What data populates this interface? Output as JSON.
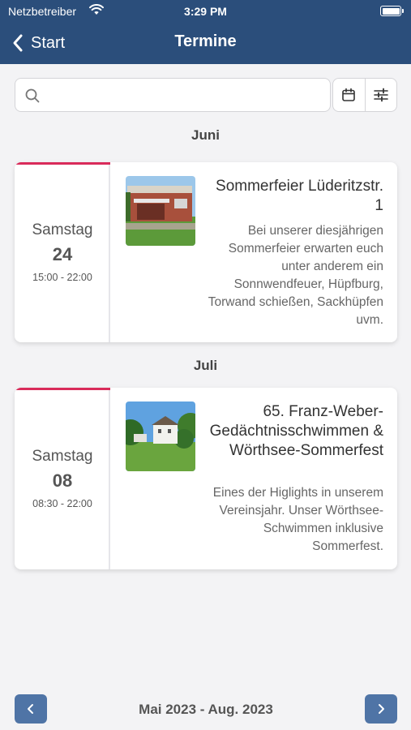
{
  "status_bar": {
    "carrier": "Netzbetreiber",
    "time": "3:29 PM"
  },
  "header": {
    "back_label": "Start",
    "title": "Termine"
  },
  "search": {
    "placeholder": "",
    "value": ""
  },
  "sections": [
    {
      "month": "Juni",
      "event": {
        "weekday": "Samstag",
        "day": "24",
        "time_range": "15:00 - 22:00",
        "title": "Sommerfeier Lüderitzstr. 1",
        "description": "Bei unserer diesjährigen Sommerfeier erwarten euch unter anderem ein Sonnwendfeuer, Hüpfburg, Torwand schießen, Sackhüpfen uvm."
      }
    },
    {
      "month": "Juli",
      "event": {
        "weekday": "Samstag",
        "day": "08",
        "time_range": "08:30 - 22:00",
        "title": "65. Franz-Weber-Gedächtnisschwimmen & Wörthsee-Sommerfest",
        "description": "Eines der Higlights in unserem Vereinsjahr. Unser Wörthsee-Schwimmen inklusive Sommerfest."
      }
    }
  ],
  "footer": {
    "range": "Mai 2023 - Aug. 2023"
  },
  "colors": {
    "header": "#2b4e7b",
    "accent": "#d92b5a",
    "nav_button": "#4f74a6"
  }
}
